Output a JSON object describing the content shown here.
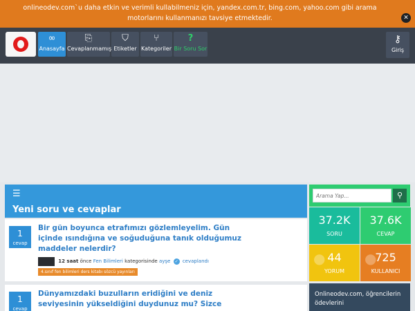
{
  "notice": {
    "text": "onlineodev.com`u daha etkin ve verimli kullabilmeniz için, yandex.com.tr, bing.com, yahoo.com gibi arama motorlarını kullanmanızı tavsiye etmektedir.",
    "close_icon": "close-icon"
  },
  "nav": {
    "logo": "onlineodev-logo",
    "items": [
      {
        "label": "Anasayfa",
        "icon": "infinity-icon",
        "active": true
      },
      {
        "label": "Cevaplanmamış",
        "icon": "unanswered-icon"
      },
      {
        "label": "Etiketler",
        "icon": "tag-icon"
      },
      {
        "label": "Kategoriler",
        "icon": "category-tree-icon"
      },
      {
        "label": "Bir Soru Sor",
        "icon": "question-icon"
      }
    ],
    "login_label": "Giriş",
    "login_icon": "key-icon"
  },
  "feed": {
    "title": "Yeni soru ve cevaplar",
    "icon": "rss-icon",
    "questions": [
      {
        "answers": "1",
        "answers_label": "cevap",
        "title": "Bir gün boyunca etrafımızı gözlemleyelim. Gün içinde ısındığına ve soğuduğuna tanık olduğumuz maddeler nelerdir?",
        "time": "12 saat",
        "time_suffix": "önce",
        "category": "Fen Bilimleri",
        "category_suffix": "kategorisinde",
        "user": "ayşe",
        "status": "cevaplandı",
        "tag": "4.sınıf fen bilimleri ders kitabı sözcü yayınları"
      },
      {
        "answers": "1",
        "answers_label": "cevap",
        "title": "Dünyamızdaki buzulların eridiğini ve deniz seviyesinin yükseldiğini duydunuz mu? Sizce bunun sebebi nedir?"
      }
    ]
  },
  "search": {
    "placeholder": "Arama Yap...",
    "icon": "search-icon"
  },
  "stats": [
    {
      "value": "37.2K",
      "label": "SORU",
      "color": "#1abc9c"
    },
    {
      "value": "37.6K",
      "label": "CEVAP",
      "color": "#2ecc71"
    },
    {
      "value": "44",
      "label": "YORUM",
      "color": "#f1c40f",
      "icon": "comments-icon"
    },
    {
      "value": "725",
      "label": "KULLANICI",
      "color": "#e67e22",
      "icon": "users-icon"
    }
  ],
  "about": {
    "text": "Onlineodev.com, öğrencilerin ödevlerini"
  }
}
